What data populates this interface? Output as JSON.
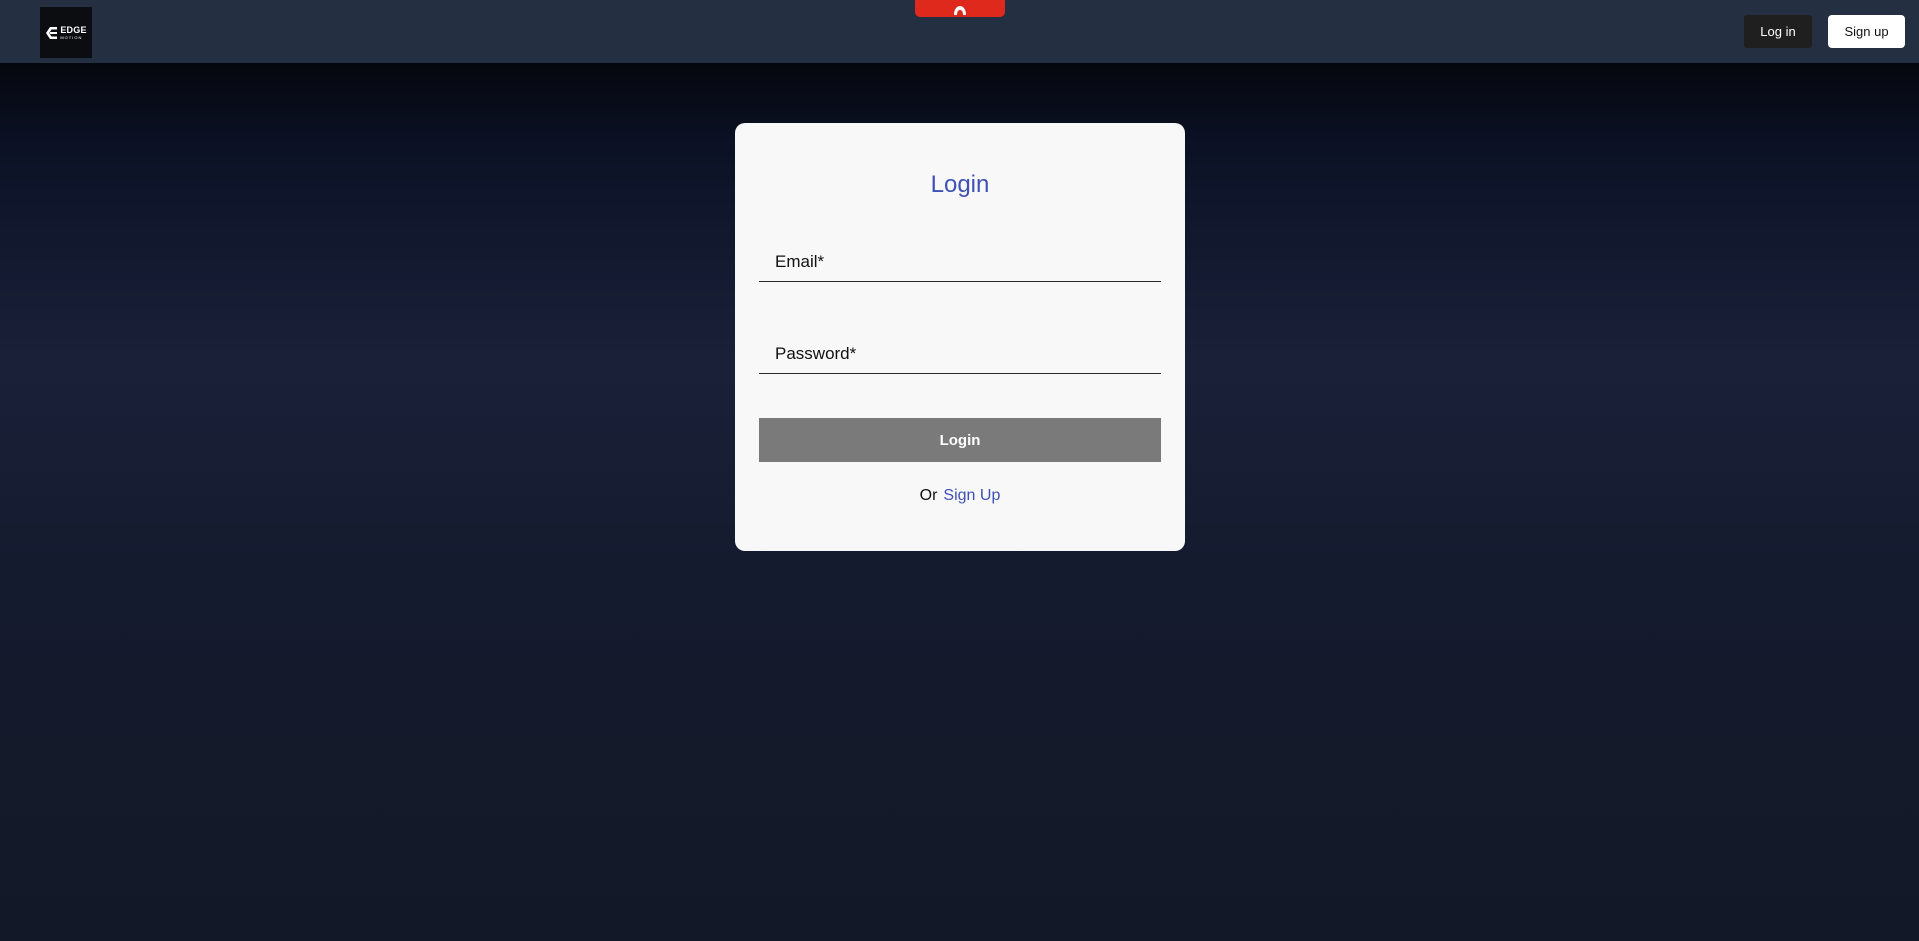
{
  "header": {
    "logo": {
      "title": "EDGE",
      "subtitle": "MOTION",
      "icon": "back-arrow-icon"
    },
    "notch_icon": "flame-icon",
    "login_label": "Log in",
    "signup_label": "Sign up"
  },
  "form": {
    "title": "Login",
    "email_placeholder": "Email*",
    "password_placeholder": "Password*",
    "submit_label": "Login",
    "alt_prefix": "Or",
    "alt_link_label": "Sign Up"
  },
  "colors": {
    "topbar": "#243042",
    "accent": "#3f51b5",
    "notch": "#e0291d",
    "submit_disabled": "#7a7a7a"
  }
}
